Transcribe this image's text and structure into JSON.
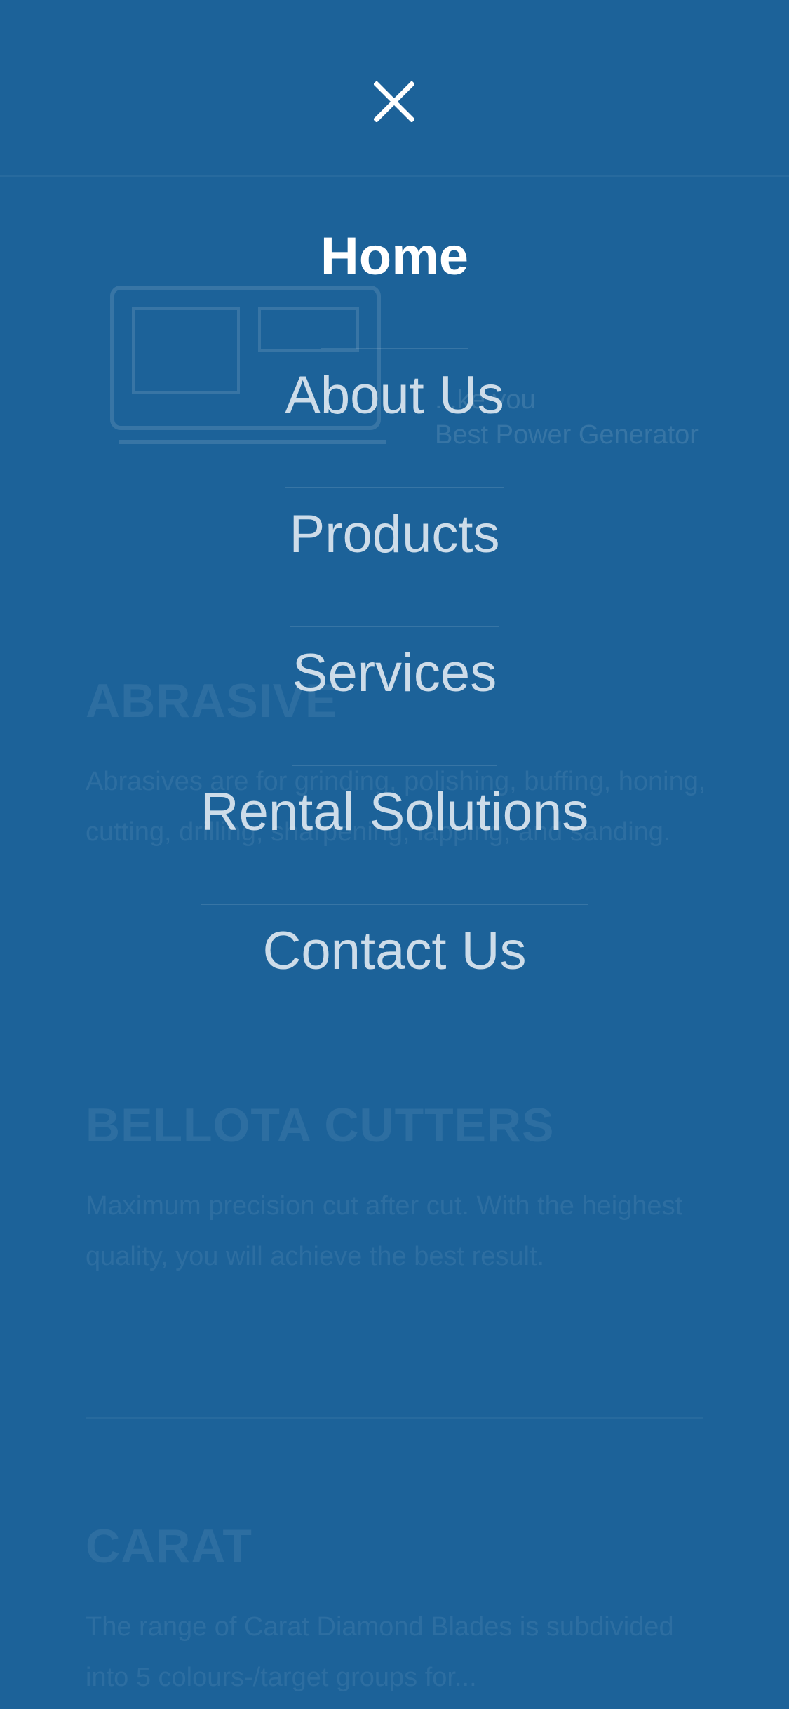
{
  "background_content": {
    "hero_caption": "...ke you\nBest Power Generator",
    "sections": [
      {
        "title": "ABRASIVE",
        "text": "Abrasives are for grinding, polishing, buffing, honing, cutting, drilling, sharpening, lapping, and sanding."
      },
      {
        "title": "BELLOTA CUTTERS",
        "text": "Maximum precision cut after cut. With the heighest quality, you will achieve the best result."
      },
      {
        "title": "CARAT",
        "text": "The range of Carat Diamond Blades is subdivided into 5 colours-/target groups for..."
      }
    ]
  },
  "menu": {
    "close_icon": "close-icon",
    "active_index": 0,
    "items": [
      {
        "label": "Home"
      },
      {
        "label": "About Us"
      },
      {
        "label": "Products"
      },
      {
        "label": "Services"
      },
      {
        "label": "Rental Solutions"
      },
      {
        "label": "Contact Us"
      }
    ]
  },
  "colors": {
    "overlay_background": "#1c6299",
    "active_text": "#ffffff",
    "inactive_text": "#c9dcec"
  }
}
